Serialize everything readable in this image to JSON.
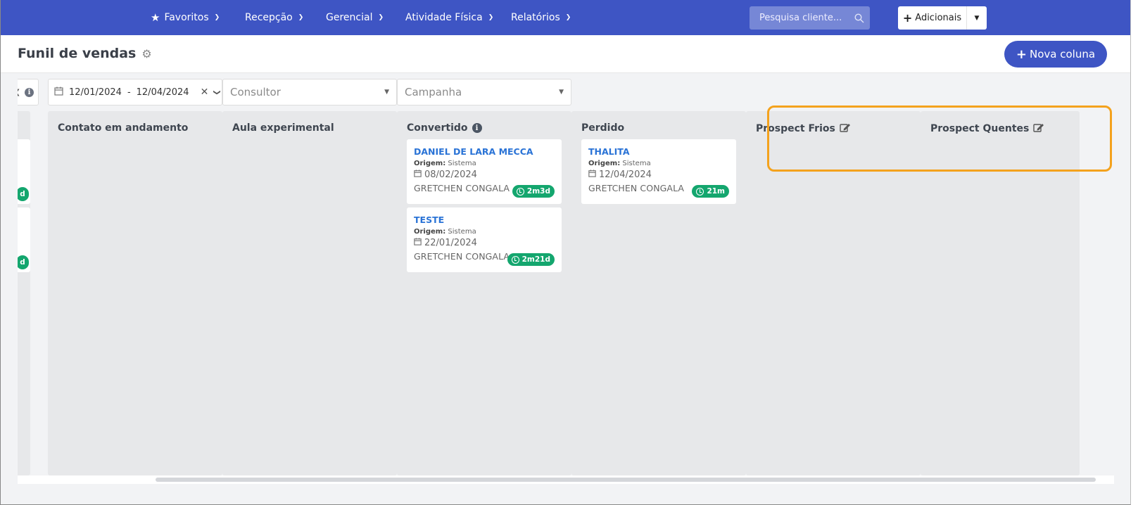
{
  "navbar": {
    "items": [
      {
        "label": "Favoritos",
        "icon": "star-icon"
      },
      {
        "label": "Recepção"
      },
      {
        "label": "Gerencial"
      },
      {
        "label": "Atividade Física"
      },
      {
        "label": "Relatórios"
      }
    ],
    "search_placeholder": "Pesquisa cliente...",
    "add_button_label": "Adicionais"
  },
  "header": {
    "title": "Funil de vendas",
    "new_column_label": "Nova coluna"
  },
  "filters": {
    "date_start": "12/01/2024",
    "date_separator": "-",
    "date_end": "12/04/2024",
    "consultor_placeholder": "Consultor",
    "campanha_placeholder": "Campanha"
  },
  "columns": [
    {
      "title": "Contato em andamento",
      "cards": []
    },
    {
      "title": "Aula experimental",
      "cards": []
    },
    {
      "title": "Convertido",
      "has_info": true,
      "cards": [
        {
          "name": "DANIEL DE LARA MECCA",
          "origin_label": "Origem:",
          "origin": "Sistema",
          "date": "08/02/2024",
          "consultant": "GRETCHEN CONGALA",
          "time": "2m3d"
        },
        {
          "name": "TESTE",
          "origin_label": "Origem:",
          "origin": "Sistema",
          "date": "22/01/2024",
          "consultant": "GRETCHEN CONGALA",
          "time": "2m21d"
        }
      ]
    },
    {
      "title": "Perdido",
      "cards": [
        {
          "name": "THALITA",
          "origin_label": "Origem:",
          "origin": "Sistema",
          "date": "12/04/2024",
          "consultant": "GRETCHEN CONGALA",
          "time": "21m"
        }
      ]
    },
    {
      "title": "Prospect Frios",
      "editable": true,
      "cards": []
    },
    {
      "title": "Prospect Quentes",
      "editable": true,
      "cards": []
    }
  ],
  "partial_column": {
    "badge_text": "d"
  },
  "colors": {
    "primary": "#3e55c4",
    "badge_green": "#14a66e",
    "link_blue": "#2a73d6",
    "highlight_orange": "#f4a21d"
  }
}
